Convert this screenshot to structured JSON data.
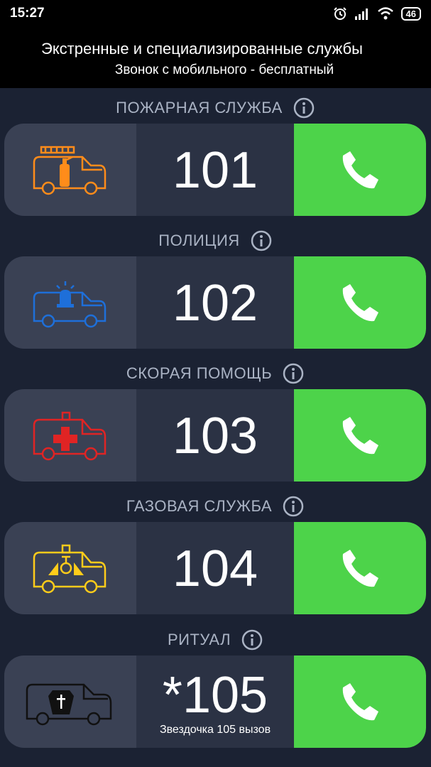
{
  "status": {
    "time": "15:27",
    "battery": "46"
  },
  "header": {
    "title": "Экстренные и специализированные службы",
    "subtitle": "Звонок с мобильного - бесплатный"
  },
  "services": [
    {
      "label": "ПОЖАРНАЯ СЛУЖБА",
      "number": "101",
      "note": "",
      "icon": "fire-truck-icon",
      "icon_color": "#ff8c1a"
    },
    {
      "label": "ПОЛИЦИЯ",
      "number": "102",
      "note": "",
      "icon": "police-car-icon",
      "icon_color": "#1e6fd9"
    },
    {
      "label": "СКОРАЯ ПОМОЩЬ",
      "number": "103",
      "note": "",
      "icon": "ambulance-icon",
      "icon_color": "#e02424"
    },
    {
      "label": "ГАЗОВАЯ СЛУЖБА",
      "number": "104",
      "note": "",
      "icon": "gas-service-van-icon",
      "icon_color": "#ffcc1a"
    },
    {
      "label": "РИТУАЛ",
      "number": "*105",
      "note": "Звездочка 105 вызов",
      "icon": "hearse-icon",
      "icon_color": "#111111"
    }
  ],
  "colors": {
    "background": "#1b2233",
    "call_button": "#4dd34a",
    "label": "#aab3c4"
  }
}
